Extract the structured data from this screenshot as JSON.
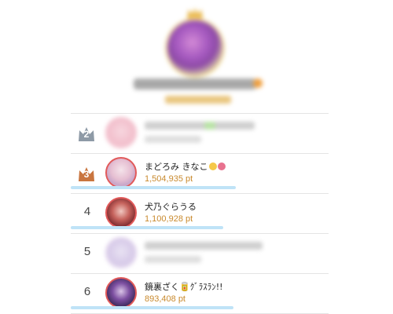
{
  "header": {
    "rank_1": {
      "name": "",
      "points": ""
    }
  },
  "ranking": [
    {
      "rank": "2",
      "name": "",
      "points": "",
      "crown_color": "#8e9aa6"
    },
    {
      "rank": "3",
      "name": "まどろみ きなこ",
      "name_suffix_icons": [
        "smile-emoji-icon",
        "flower-emoji-icon"
      ],
      "points": "1,504,935 pt",
      "crown_color": "#c9753f",
      "progress": 0.64
    },
    {
      "rank": "4",
      "name": "犬乃ぐらうる",
      "points": "1,100,928 pt",
      "progress": 0.59
    },
    {
      "rank": "5",
      "name": "",
      "points": ""
    },
    {
      "rank": "6",
      "name": "鏡裏ざく",
      "name_suffix": "🥫ｸﾞﾗｽﾗﾝ!!",
      "points": "893,408 pt",
      "progress": 0.63
    }
  ],
  "colors": {
    "points_text": "#c98a2e",
    "progress_bar": "#bfe3f7",
    "avatar_border": "#e25a5a",
    "divider": "#e4e4e4"
  }
}
